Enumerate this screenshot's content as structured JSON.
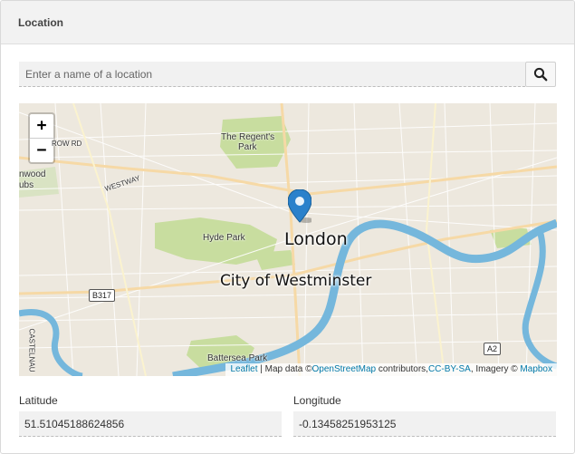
{
  "panel": {
    "title": "Location"
  },
  "search": {
    "placeholder": "Enter a name of a location",
    "value": ""
  },
  "search_button": {
    "icon": "search-icon"
  },
  "map": {
    "zoom_in": "+",
    "zoom_out": "−",
    "places": {
      "london": "London",
      "westminster": "City of Westminster",
      "hyde_park": "Hyde Park",
      "regents_park_1": "The Regent's",
      "regents_park_2": "Park",
      "battersea": "Battersea Park",
      "westway": "WESTWAY",
      "row_rd": "ROW RD",
      "hwood_1": "nwood",
      "hwood_2": "ubs",
      "castelnau": "CASTELNAU"
    },
    "shields": {
      "b317": "B317",
      "a2": "A2"
    },
    "attribution": {
      "leaflet": "Leaflet",
      "sep": " | Map data ©",
      "osm": "OpenStreetMap",
      "contributors": " contributors,",
      "ccbysa": "CC-BY-SA",
      "imagery": ", Imagery © ",
      "mapbox": "Mapbox"
    },
    "colors": {
      "water": "#75b7dc",
      "park": "#c8dd9f",
      "land": "#ede8de",
      "marker": "#2a81cb"
    }
  },
  "latitude": {
    "label": "Latitude",
    "value": "51.51045188624856"
  },
  "longitude": {
    "label": "Longitude",
    "value": "-0.13458251953125"
  }
}
